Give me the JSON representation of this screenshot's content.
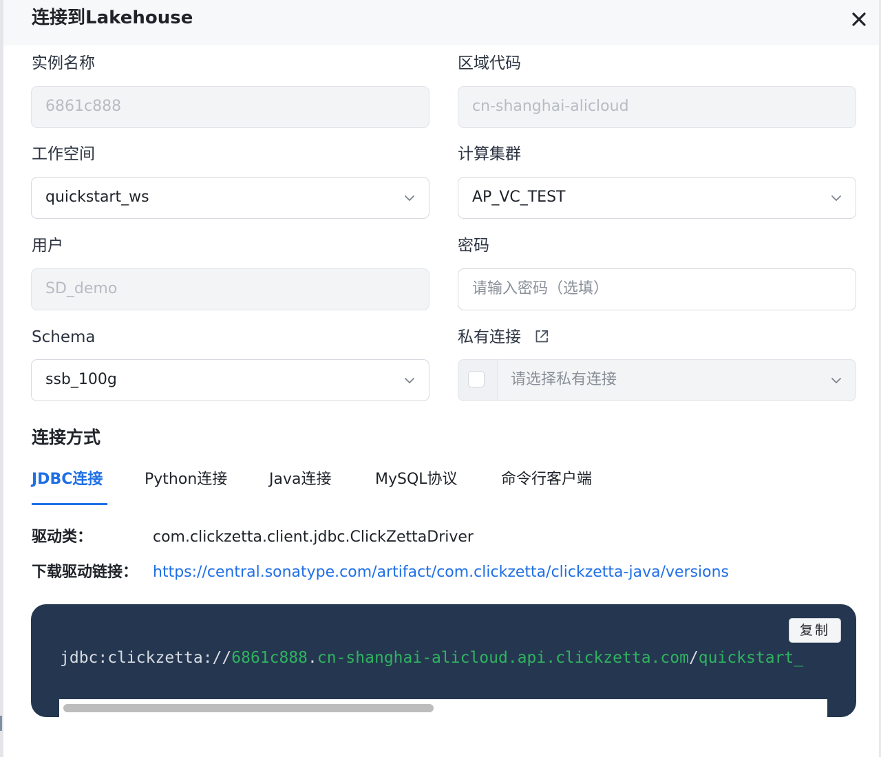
{
  "dialog": {
    "title": "连接到Lakehouse",
    "close_icon": "close-icon"
  },
  "form": {
    "instance_name": {
      "label": "实例名称",
      "value": "6861c888"
    },
    "region_code": {
      "label": "区域代码",
      "value": "cn-shanghai-alicloud"
    },
    "workspace": {
      "label": "工作空间",
      "value": "quickstart_ws"
    },
    "compute_cluster": {
      "label": "计算集群",
      "value": "AP_VC_TEST"
    },
    "user": {
      "label": "用户",
      "value": "SD_demo"
    },
    "password": {
      "label": "密码",
      "placeholder": "请输入密码（选填）"
    },
    "schema": {
      "label": "Schema",
      "value": "ssb_100g"
    },
    "private_connection": {
      "label": "私有连接",
      "placeholder": "请选择私有连接",
      "checked": false
    }
  },
  "connection": {
    "section_title": "连接方式",
    "tabs": [
      {
        "label": "JDBC连接",
        "active": true
      },
      {
        "label": "Python连接",
        "active": false
      },
      {
        "label": "Java连接",
        "active": false
      },
      {
        "label": "MySQL协议",
        "active": false
      },
      {
        "label": "命令行客户端",
        "active": false
      }
    ],
    "driver_class_label": "驱动类：",
    "driver_class_value": "com.clickzetta.client.jdbc.ClickZettaDriver",
    "download_label": "下载驱动链接：",
    "download_url": "https://central.sonatype.com/artifact/com.clickzetta/clickzetta-java/versions",
    "code": {
      "prefix": "jdbc:clickzetta://",
      "instance": "6861c888",
      "dot": ".",
      "host": "cn-shanghai-alicloud.api.clickzetta.com",
      "slash": "/",
      "workspace": "quickstart_"
    },
    "copy_label": "复制",
    "scroll_position": 0
  },
  "colors": {
    "accent": "#1f6fe5",
    "code_bg": "#253750",
    "code_highlight": "#2fb35f"
  }
}
